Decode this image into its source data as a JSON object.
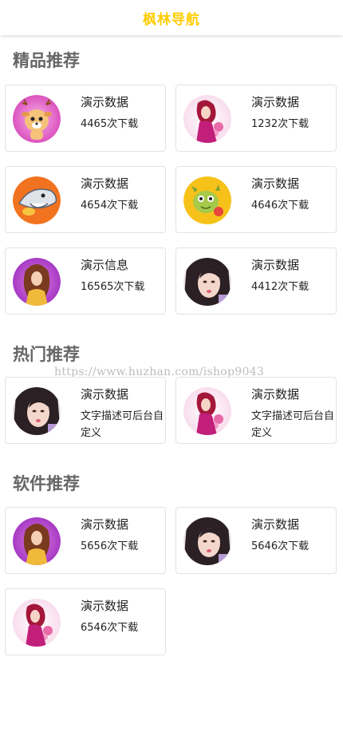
{
  "header": {
    "title": "枫林导航",
    "title_color": "#ffcc00"
  },
  "watermark": {
    "text": "https://www.huzhan.com/ishop9043"
  },
  "sections": {
    "featured": {
      "title": "精品推荐",
      "items": [
        {
          "title": "演示数据",
          "sub": "4465次下载",
          "icon": "deer-cartoon-icon"
        },
        {
          "title": "演示数据",
          "sub": "1232次下载",
          "icon": "woman-red-hair-icon"
        },
        {
          "title": "演示数据",
          "sub": "4654次下载",
          "icon": "shark-cartoon-icon"
        },
        {
          "title": "演示数据",
          "sub": "4646次下载",
          "icon": "dragon-cartoon-icon"
        },
        {
          "title": "演示信息",
          "sub": "16565次下载",
          "icon": "woman-purple-bg-icon"
        },
        {
          "title": "演示数据",
          "sub": "4412次下载",
          "icon": "girl-photo-icon"
        }
      ]
    },
    "hot": {
      "title": "热门推荐",
      "items": [
        {
          "title": "演示数据",
          "sub": "文字描述可后台自定义",
          "icon": "girl-photo-icon"
        },
        {
          "title": "演示数据",
          "sub": "文字描述可后台自定义",
          "icon": "woman-red-hair-icon"
        }
      ]
    },
    "software": {
      "title": "软件推荐",
      "items": [
        {
          "title": "演示数据",
          "sub": "5656次下载",
          "icon": "woman-purple-bg-icon"
        },
        {
          "title": "演示数据",
          "sub": "5646次下载",
          "icon": "girl-photo-icon"
        },
        {
          "title": "演示数据",
          "sub": "6546次下载",
          "icon": "woman-red-hair-icon"
        }
      ]
    }
  }
}
